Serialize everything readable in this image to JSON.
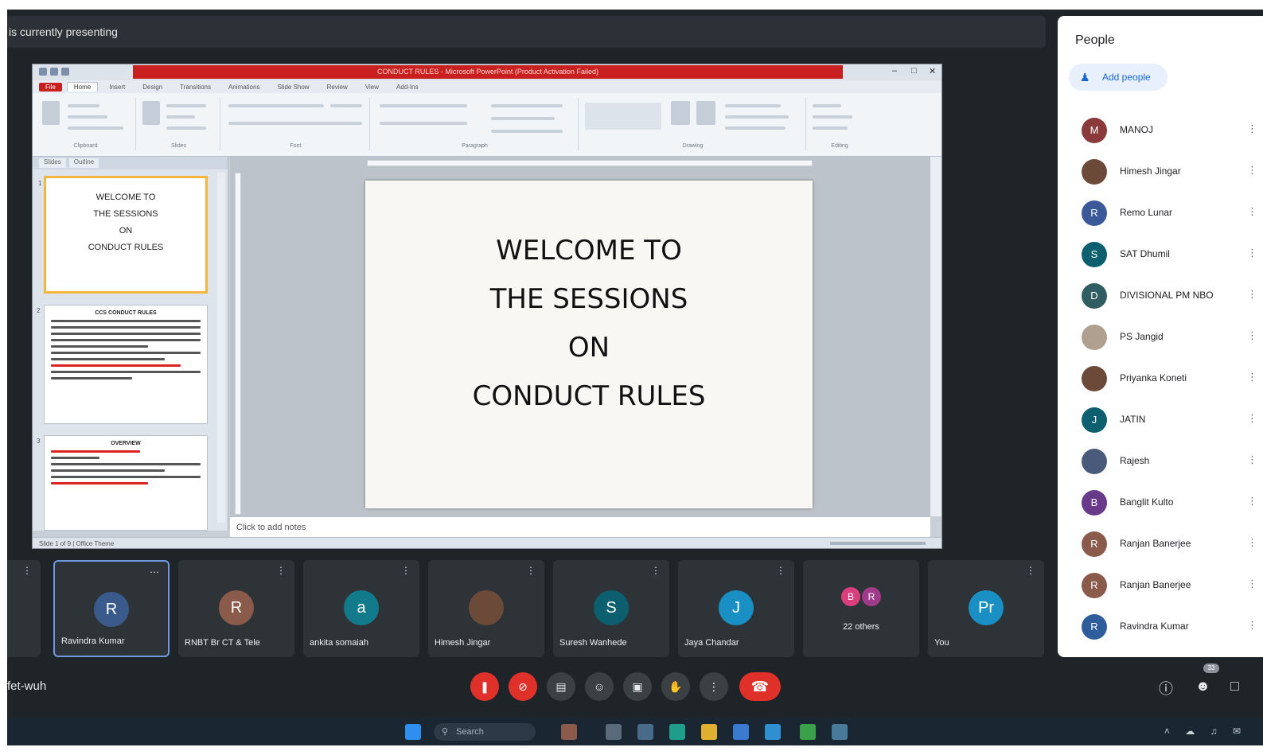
{
  "presenting_banner": "is currently presenting",
  "ppt": {
    "title": "CONDUCT RULES - Microsoft PowerPoint (Product Activation Failed)",
    "tabs": [
      "File",
      "Home",
      "Insert",
      "Design",
      "Transitions",
      "Animations",
      "Slide Show",
      "Review",
      "View",
      "Add-Ins"
    ],
    "ribbon_groups": [
      "Clipboard",
      "Slides",
      "Font",
      "Paragraph",
      "Drawing",
      "Editing"
    ],
    "left_tabs": [
      "Slides",
      "Outline"
    ],
    "slide1_thumb": [
      "WELCOME TO",
      "THE SESSIONS",
      "ON",
      "CONDUCT RULES"
    ],
    "slide2_thumb_heading": "CCS CONDUCT RULES",
    "slide3_thumb_heading": "OVERVIEW",
    "slide_lines": [
      "WELCOME TO",
      "THE SESSIONS",
      "ON",
      "CONDUCT RULES"
    ],
    "notes_placeholder": "Click to add notes",
    "status": "Slide 1 of 9 | Office Theme"
  },
  "tiles": [
    {
      "initial": "",
      "name": "",
      "color": "#2e3338"
    },
    {
      "initial": "R",
      "name": "Ravindra Kumar",
      "color": "#3a5a8c",
      "speaking": true
    },
    {
      "initial": "R",
      "name": "RNBT Br CT & Tele",
      "color": "#8a5a4a"
    },
    {
      "initial": "a",
      "name": "ankita somaiah",
      "color": "#117a8b"
    },
    {
      "initial": "",
      "name": "Himesh Jingar",
      "color": "#6b4a3a"
    },
    {
      "initial": "S",
      "name": "Suresh Wanhede",
      "color": "#0b5f6e"
    },
    {
      "initial": "J",
      "name": "Jaya Chandar",
      "color": "#1a8fc4"
    },
    {
      "initial": "",
      "name": "22 others",
      "color": "#2e3338"
    },
    {
      "initial": "Pr",
      "name": "You",
      "color": "#1a8fc4"
    }
  ],
  "others_avatars": [
    "B",
    "R"
  ],
  "bottom": {
    "meeting_code": "fet-wuh",
    "controls": [
      "mic-off",
      "camera-off",
      "captions",
      "emoji",
      "present",
      "raise-hand",
      "more",
      "leave"
    ]
  },
  "taskbar": {
    "search": "Search"
  },
  "people": {
    "title": "People",
    "add_people": "Add people",
    "list": [
      {
        "initial": "M",
        "name": "MANOJ",
        "color": "#8a3a3a"
      },
      {
        "initial": "",
        "name": "Himesh Jingar",
        "color": "#6b4a3a"
      },
      {
        "initial": "R",
        "name": "Remo Lunar",
        "color": "#3b5998"
      },
      {
        "initial": "S",
        "name": "SAT Dhumil",
        "color": "#0b5f6e"
      },
      {
        "initial": "D",
        "name": "DIVISIONAL PM NBO",
        "color": "#2f5d62"
      },
      {
        "initial": "",
        "name": "PS Jangid",
        "color": "#b0a090"
      },
      {
        "initial": "",
        "name": "Priyanka Koneti",
        "color": "#6b4a3a"
      },
      {
        "initial": "J",
        "name": "JATIN",
        "color": "#0b5f6e"
      },
      {
        "initial": "",
        "name": "Rajesh",
        "color": "#4a5a7a"
      },
      {
        "initial": "B",
        "name": "Banglit Kulto",
        "color": "#6a3a8a"
      },
      {
        "initial": "R",
        "name": "Ranjan Banerjee",
        "color": "#8a5a4a"
      },
      {
        "initial": "R",
        "name": "Ranjan Banerjee",
        "color": "#8a5a4a"
      },
      {
        "initial": "R",
        "name": "Ravindra Kumar",
        "color": "#2f5d9c"
      }
    ]
  }
}
